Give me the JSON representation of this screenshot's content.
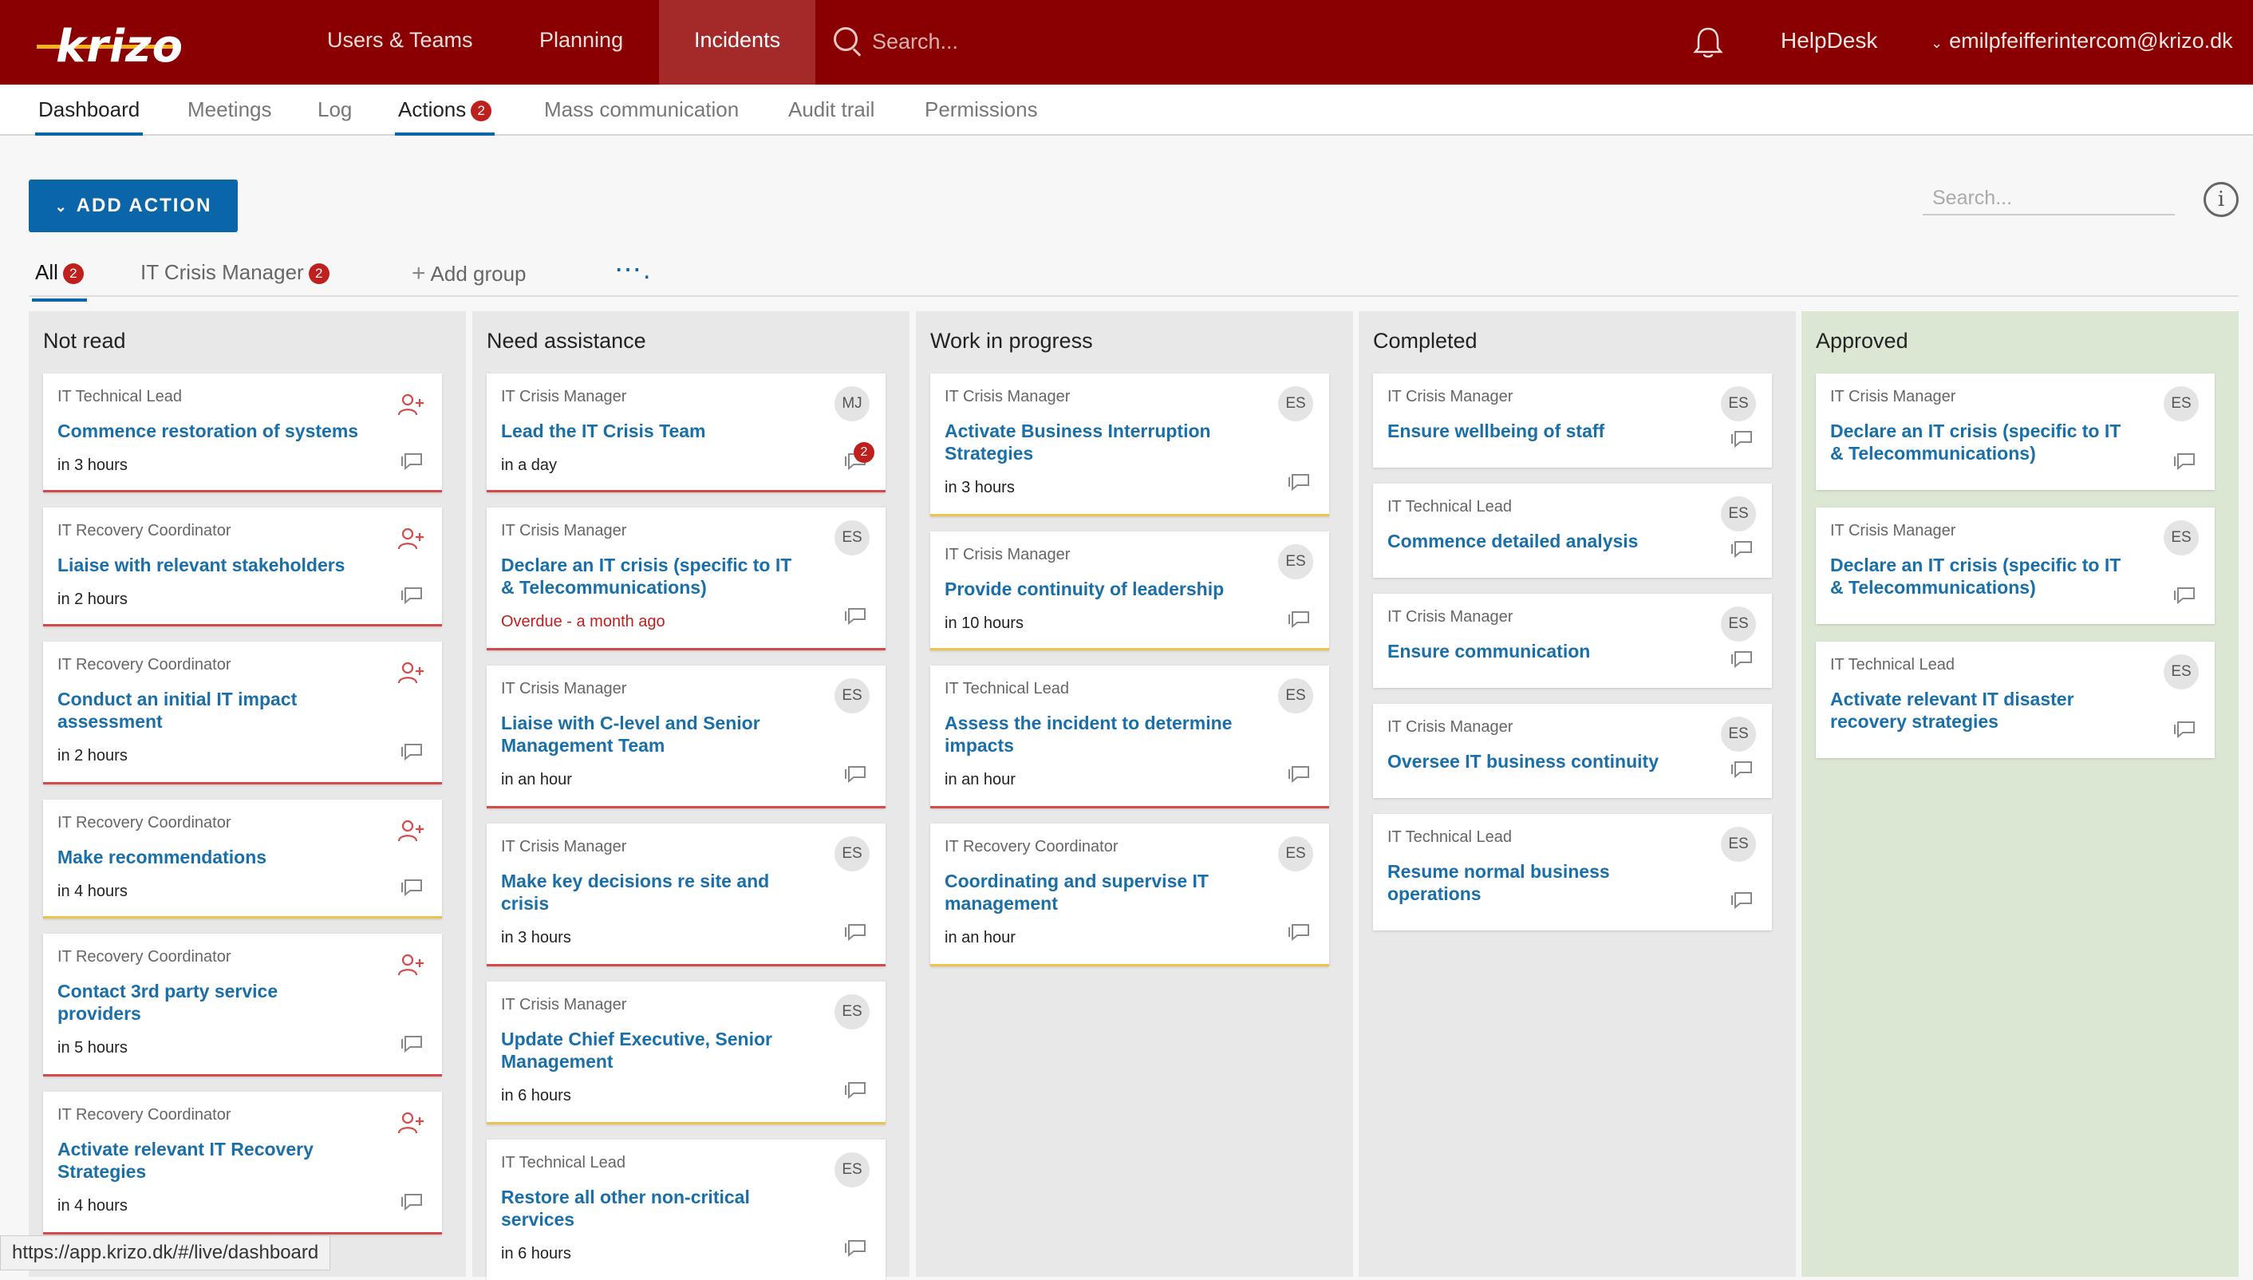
{
  "app": {
    "logo": "krizo",
    "nav": [
      "Users & Teams",
      "Planning",
      "Incidents"
    ],
    "active_nav": "Incidents",
    "search_placeholder": "Search...",
    "helpdesk": "HelpDesk",
    "user_email": "emilpfeifferintercom@krizo.dk",
    "brand_color": "#8a0000",
    "accent_color": "#0a66a9"
  },
  "subnav": {
    "tabs": [
      "Dashboard",
      "Meetings",
      "Log",
      "Actions",
      "Mass communication",
      "Audit trail",
      "Permissions"
    ],
    "actions_badge": "2"
  },
  "toolbar": {
    "add_action": "ADD ACTION",
    "search_placeholder": "Search..."
  },
  "groups": {
    "all": "All",
    "all_badge": "2",
    "it_crisis_manager": "IT Crisis Manager",
    "icm_badge": "2",
    "add_group": "Add group",
    "more": "⋯."
  },
  "columns": [
    {
      "title": "Not read",
      "cards": [
        {
          "role": "IT Technical Lead",
          "title": "Commence restoration of systems",
          "due": "in 3 hours"
        },
        {
          "role": "IT Recovery Coordinator",
          "title": "Liaise with relevant stakeholders",
          "due": "in 2 hours"
        },
        {
          "role": "IT Recovery Coordinator",
          "title": "Conduct an initial IT impact assessment",
          "due": "in 2 hours"
        },
        {
          "role": "IT Recovery Coordinator",
          "title": "Make recommendations",
          "due": "in 4 hours"
        },
        {
          "role": "IT Recovery Coordinator",
          "title": "Contact 3rd party service providers",
          "due": "in 5 hours"
        },
        {
          "role": "IT Recovery Coordinator",
          "title": "Activate relevant IT Recovery Strategies",
          "due": "in 4 hours"
        }
      ]
    },
    {
      "title": "Need assistance",
      "cards": [
        {
          "role": "IT Crisis Manager",
          "title": "Lead the IT Crisis Team",
          "due": "in a day",
          "avatar": "MJ",
          "comments": "2"
        },
        {
          "role": "IT Crisis Manager",
          "title": "Declare an IT crisis (specific to IT & Telecommunications)",
          "due": "Overdue - a month ago",
          "avatar": "ES"
        },
        {
          "role": "IT Crisis Manager",
          "title": "Liaise with C-level and Senior Management Team",
          "due": "in an hour",
          "avatar": "ES"
        },
        {
          "role": "IT Crisis Manager",
          "title": "Make key decisions re site and crisis",
          "due": "in 3 hours",
          "avatar": "ES"
        },
        {
          "role": "IT Crisis Manager",
          "title": "Update Chief Executive, Senior Management",
          "due": "in 6 hours",
          "avatar": "ES"
        },
        {
          "role": "IT Technical Lead",
          "title": "Restore all other non-critical services",
          "due": "in 6 hours",
          "avatar": "ES"
        }
      ]
    },
    {
      "title": "Work in progress",
      "cards": [
        {
          "role": "IT Crisis Manager",
          "title": "Activate Business Interruption Strategies",
          "due": "in 3 hours",
          "avatar": "ES"
        },
        {
          "role": "IT Crisis Manager",
          "title": "Provide continuity of leadership",
          "due": "in 10 hours",
          "avatar": "ES"
        },
        {
          "role": "IT Technical Lead",
          "title": "Assess the incident to determine impacts",
          "due": "in an hour",
          "avatar": "ES"
        },
        {
          "role": "IT Recovery Coordinator",
          "title": "Coordinating and supervise IT management",
          "due": "in an hour",
          "avatar": "ES"
        }
      ]
    },
    {
      "title": "Completed",
      "cards": [
        {
          "role": "IT Crisis Manager",
          "title": "Ensure wellbeing of staff",
          "avatar": "ES"
        },
        {
          "role": "IT Technical Lead",
          "title": "Commence detailed analysis",
          "avatar": "ES"
        },
        {
          "role": "IT Crisis Manager",
          "title": "Ensure communication",
          "avatar": "ES"
        },
        {
          "role": "IT Crisis Manager",
          "title": "Oversee IT business continuity",
          "avatar": "ES"
        },
        {
          "role": "IT Technical Lead",
          "title": "Resume normal business operations",
          "avatar": "ES"
        }
      ]
    },
    {
      "title": "Approved",
      "cards": [
        {
          "role": "IT Crisis Manager",
          "title": "Declare an IT crisis (specific to IT & Telecommunications)",
          "avatar": "ES"
        },
        {
          "role": "IT Crisis Manager",
          "title": "Declare an IT crisis (specific to IT & Telecommunications)",
          "avatar": "ES"
        },
        {
          "role": "IT Technical Lead",
          "title": "Activate relevant IT disaster recovery strategies",
          "avatar": "ES"
        }
      ]
    }
  ],
  "statusbar": "https://app.krizo.dk/#/live/dashboard"
}
